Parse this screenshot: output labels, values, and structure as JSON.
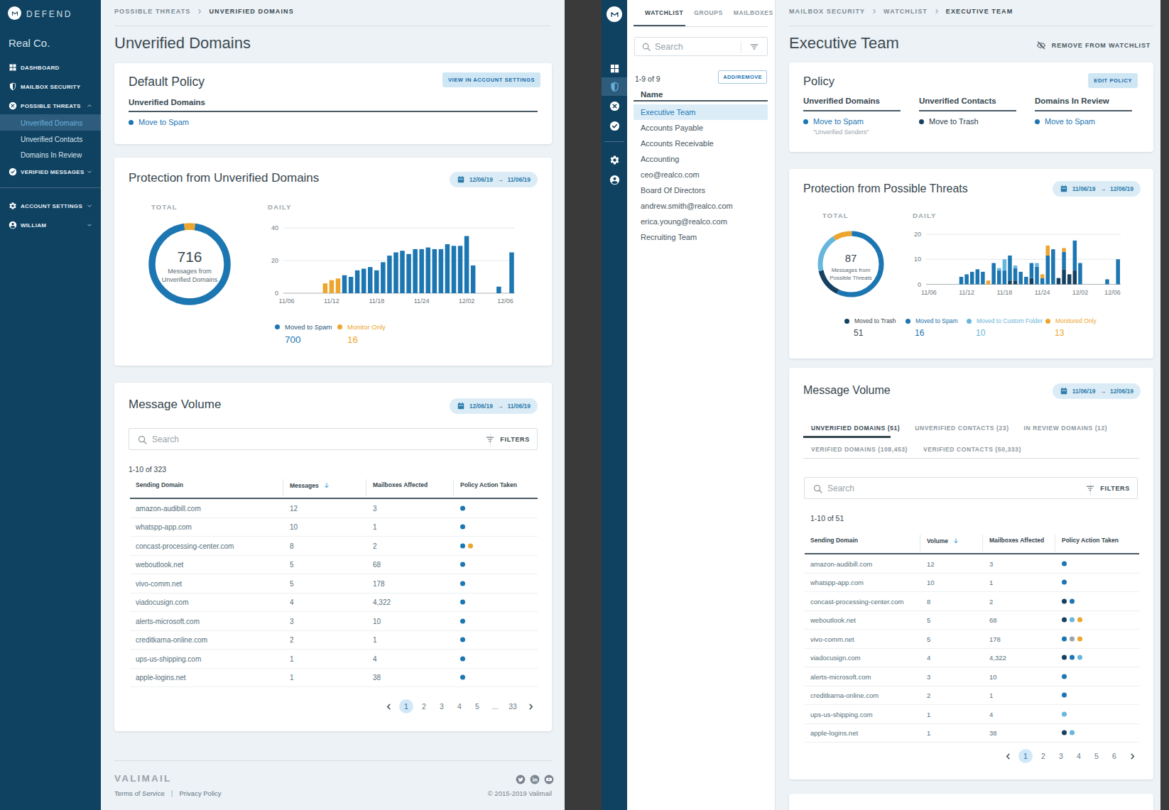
{
  "palette": {
    "blue": "#1c76b2",
    "orange": "#eda52e",
    "lightblue": "#67b7dc",
    "navy": "#16405f",
    "gray": "#9aa4ab",
    "sidebar": "#0f4161",
    "accent_chip": "#dcecf7"
  },
  "left_app": {
    "sidebar": {
      "product": "DEFEND",
      "org": "Real Co.",
      "items": [
        {
          "label": "DASHBOARD",
          "icon": "dashboard"
        },
        {
          "label": "MAILBOX SECURITY",
          "icon": "shield"
        },
        {
          "label": "POSSIBLE THREATS",
          "icon": "x-circle",
          "chevron": "up",
          "children": [
            "Unverified Domains",
            "Unverified Contacts",
            "Domains In Review"
          ],
          "selected_child": 0
        },
        {
          "label": "VERIFIED MESSAGES",
          "icon": "check-circle",
          "chevron": "down"
        }
      ],
      "footer_items": [
        {
          "label": "ACCOUNT SETTINGS",
          "icon": "gear",
          "chevron": "down"
        },
        {
          "label": "WILLIAM",
          "icon": "person",
          "chevron": "down"
        }
      ]
    },
    "breadcrumb": [
      "POSSIBLE THREATS",
      "UNVERIFIED DOMAINS"
    ],
    "page_title": "Unverified Domains",
    "default_policy": {
      "title": "Default Policy",
      "button": "VIEW IN ACCOUNT SETTINGS",
      "section_label": "Unverified Domains",
      "action": {
        "label": "Move to Spam",
        "color": "blue"
      }
    },
    "protection": {
      "title": "Protection from Unverified Domains",
      "date_from": "12/06/19",
      "date_to": "11/06/19",
      "total_label": "TOTAL",
      "daily_label": "DAILY",
      "legend": [
        {
          "label": "Moved to Spam",
          "value": "700",
          "dot": "blue",
          "label_color": "#2c5878",
          "value_color": "#1c76b2"
        },
        {
          "label": "Monitor Only",
          "value": "16",
          "dot": "orange",
          "label_color": "#eda52e",
          "value_color": "#eda52e"
        }
      ]
    },
    "message_volume": {
      "title": "Message Volume",
      "date_from": "12/06/19",
      "date_to": "11/06/19",
      "search_placeholder": "Search",
      "filters_label": "FILTERS",
      "count": "1-10 of 323",
      "columns": [
        "Sending Domain",
        "Messages",
        "Mailboxes Affected",
        "Policy Action Taken"
      ],
      "sorted_column": 1,
      "rows": [
        {
          "domain": "amazon-audibill.com",
          "messages": "12",
          "mailboxes": "3",
          "actions": [
            "blue"
          ]
        },
        {
          "domain": "whatspp-app.com",
          "messages": "10",
          "mailboxes": "1",
          "actions": [
            "blue"
          ]
        },
        {
          "domain": "concast-processing-center.com",
          "messages": "8",
          "mailboxes": "2",
          "actions": [
            "blue",
            "orange"
          ]
        },
        {
          "domain": "weboutlook.net",
          "messages": "5",
          "mailboxes": "68",
          "actions": [
            "blue"
          ]
        },
        {
          "domain": "vivo-comm.net",
          "messages": "5",
          "mailboxes": "178",
          "actions": [
            "blue"
          ]
        },
        {
          "domain": "viadocusign.com",
          "messages": "4",
          "mailboxes": "4,322",
          "actions": [
            "blue"
          ]
        },
        {
          "domain": "alerts-microsoft.com",
          "messages": "3",
          "mailboxes": "10",
          "actions": [
            "blue"
          ]
        },
        {
          "domain": "creditkarna-online.com",
          "messages": "2",
          "mailboxes": "1",
          "actions": [
            "blue"
          ]
        },
        {
          "domain": "ups-us-shipping.com",
          "messages": "1",
          "mailboxes": "4",
          "actions": [
            "blue"
          ]
        },
        {
          "domain": "apple-logins.net",
          "messages": "1",
          "mailboxes": "38",
          "actions": [
            "blue"
          ]
        }
      ],
      "pagination": [
        "1",
        "2",
        "3",
        "4",
        "5",
        "...",
        "33"
      ],
      "active_page": "1"
    },
    "footer": {
      "brand": "VALIMAIL",
      "links": [
        "Terms of Service",
        "Privacy Policy"
      ],
      "social": [
        "twitter",
        "linkedin",
        "youtube"
      ],
      "copyright": "© 2015-2019 Valimail"
    }
  },
  "right_app": {
    "mini_sidebar": {
      "items": [
        {
          "icon": "dashboard"
        },
        {
          "icon": "shield",
          "selected": true
        },
        {
          "icon": "x-circle"
        },
        {
          "icon": "check-circle"
        }
      ],
      "footer_items": [
        {
          "icon": "gear"
        },
        {
          "icon": "person"
        }
      ]
    },
    "list_panel": {
      "tabs": [
        "WATCHLIST",
        "GROUPS",
        "MAILBOXES"
      ],
      "active_tab": 0,
      "search_placeholder": "Search",
      "count": "1-9 of 9",
      "button": "ADD/REMOVE",
      "column": "Name",
      "items": [
        "Executive Team",
        "Accounts Payable",
        "Accounts Receivable",
        "Accounting",
        "ceo@realco.com",
        "Board Of Directors",
        "andrew.smith@realco.com",
        "erica.young@realco.com",
        "Recruiting Team"
      ],
      "selected_item": 0
    },
    "breadcrumb": [
      "MAILBOX SECURITY",
      "WATCHLIST",
      "EXECUTIVE TEAM"
    ],
    "page_title": "Executive Team",
    "remove_link": "REMOVE FROM WATCHLIST",
    "policy": {
      "title": "Policy",
      "button": "EDIT POLICY",
      "columns": [
        {
          "label": "Unverified Domains",
          "action": "Move to Spam",
          "color": "blue",
          "note": "\"Unverified Senders\""
        },
        {
          "label": "Unverified Contacts",
          "action": "Move to Trash",
          "color": "navy"
        },
        {
          "label": "Domains In Review",
          "action": "Move to Spam",
          "color": "blue"
        }
      ]
    },
    "protection": {
      "title": "Protection from Possible Threats",
      "date_from": "11/06/19",
      "date_to": "12/06/19",
      "total_label": "TOTAL",
      "daily_label": "DAILY",
      "legend": [
        {
          "label": "Moved to Trash",
          "value": "51",
          "dot": "navy",
          "label_color": "#37474f",
          "value_color": "#37474f"
        },
        {
          "label": "Moved to Spam",
          "value": "16",
          "dot": "blue",
          "label_color": "#1d6fa8",
          "value_color": "#1c76b2"
        },
        {
          "label": "Moved to Custom Folder",
          "value": "10",
          "dot": "lightblue",
          "label_color": "#6ab5d8",
          "value_color": "#6ab5d8"
        },
        {
          "label": "Monitored Only",
          "value": "13",
          "dot": "orange",
          "label_color": "#eda52e",
          "value_color": "#eda52e"
        }
      ]
    },
    "message_volume": {
      "title": "Message Volume",
      "date_from": "11/06/19",
      "date_to": "12/06/19",
      "tab_rows": [
        [
          "UNVERIFIED DOMAINS (51)",
          "UNVERIFIED CONTACTS (23)",
          "IN REVIEW DOMAINS (12)"
        ],
        [
          "VERIFIED DOMAINS (108,453)",
          "VERIFIED CONTACTS (50,333)"
        ]
      ],
      "active_tab": "UNVERIFIED DOMAINS (51)",
      "search_placeholder": "Search",
      "filters_label": "FILTERS",
      "count": "1-10 of 51",
      "columns": [
        "Sending Domain",
        "Volume",
        "Mailboxes Affected",
        "Policy Action Taken"
      ],
      "sorted_column": 1,
      "rows": [
        {
          "domain": "amazon-audibill.com",
          "messages": "12",
          "mailboxes": "3",
          "actions": [
            "blue"
          ]
        },
        {
          "domain": "whatspp-app.com",
          "messages": "10",
          "mailboxes": "1",
          "actions": [
            "blue"
          ]
        },
        {
          "domain": "concast-processing-center.com",
          "messages": "8",
          "mailboxes": "2",
          "actions": [
            "navy",
            "blue"
          ]
        },
        {
          "domain": "weboutlook.net",
          "messages": "5",
          "mailboxes": "68",
          "actions": [
            "navy",
            "lightblue",
            "orange"
          ]
        },
        {
          "domain": "vivo-comm.net",
          "messages": "5",
          "mailboxes": "178",
          "actions": [
            "blue",
            "gray",
            "orange"
          ]
        },
        {
          "domain": "viadocusign.com",
          "messages": "4",
          "mailboxes": "4,322",
          "actions": [
            "navy",
            "blue",
            "lightblue"
          ]
        },
        {
          "domain": "alerts-microsoft.com",
          "messages": "3",
          "mailboxes": "10",
          "actions": [
            "blue"
          ]
        },
        {
          "domain": "creditkarna-online.com",
          "messages": "2",
          "mailboxes": "1",
          "actions": [
            "blue"
          ]
        },
        {
          "domain": "ups-us-shipping.com",
          "messages": "1",
          "mailboxes": "4",
          "actions": [
            "lightblue"
          ]
        },
        {
          "domain": "apple-logins.net",
          "messages": "1",
          "mailboxes": "38",
          "actions": [
            "navy",
            "lightblue"
          ]
        }
      ],
      "pagination": [
        "1",
        "2",
        "3",
        "4",
        "5",
        "6"
      ],
      "active_page": "1"
    }
  },
  "chart_data": [
    {
      "id": "left_total_donut",
      "type": "donut",
      "title": "Messages from Unverified Domains - Total",
      "value": "716",
      "caption": [
        "Messages from",
        "Unverified Domains"
      ],
      "segments": [
        {
          "name": "Monitor Only",
          "color": "orange",
          "pct": 4.5,
          "start": 97.75
        },
        {
          "name": "Moved to Spam",
          "color": "blue",
          "pct": 95.5,
          "start": 2.25
        }
      ]
    },
    {
      "id": "left_daily",
      "type": "bar",
      "title": "Messages from Unverified Domains - Daily",
      "ylim": [
        0,
        40
      ],
      "yticks": [
        0,
        20,
        40
      ],
      "slots": 36,
      "xticks": [
        {
          "label": "11/06",
          "slot": 0
        },
        {
          "label": "11/12",
          "slot": 7
        },
        {
          "label": "11/18",
          "slot": 14
        },
        {
          "label": "11/24",
          "slot": 21
        },
        {
          "label": "12/02",
          "slot": 28
        },
        {
          "label": "12/06",
          "slot": 34
        }
      ],
      "series": {
        "monitor": "Monitor Only",
        "spam": "Moved to Spam"
      },
      "bars": [
        {
          "slot": 6,
          "value": 6,
          "series": "monitor"
        },
        {
          "slot": 7,
          "value": 8,
          "series": "monitor"
        },
        {
          "slot": 8,
          "value": 9,
          "series": "monitor"
        },
        {
          "slot": 9,
          "value": 11,
          "series": "spam"
        },
        {
          "slot": 10,
          "value": 10,
          "series": "spam"
        },
        {
          "slot": 11,
          "value": 14,
          "series": "spam"
        },
        {
          "slot": 12,
          "value": 15,
          "series": "spam"
        },
        {
          "slot": 13,
          "value": 16,
          "series": "spam"
        },
        {
          "slot": 14,
          "value": 14,
          "series": "spam"
        },
        {
          "slot": 15,
          "value": 19,
          "series": "spam"
        },
        {
          "slot": 16,
          "value": 23,
          "series": "spam"
        },
        {
          "slot": 17,
          "value": 25,
          "series": "spam"
        },
        {
          "slot": 18,
          "value": 26,
          "series": "spam"
        },
        {
          "slot": 19,
          "value": 24,
          "series": "spam"
        },
        {
          "slot": 20,
          "value": 27,
          "series": "spam"
        },
        {
          "slot": 21,
          "value": 27,
          "series": "spam"
        },
        {
          "slot": 22,
          "value": 28,
          "series": "spam"
        },
        {
          "slot": 23,
          "value": 27,
          "series": "spam"
        },
        {
          "slot": 24,
          "value": 27,
          "series": "spam"
        },
        {
          "slot": 25,
          "value": 30,
          "series": "spam"
        },
        {
          "slot": 26,
          "value": 29,
          "series": "spam"
        },
        {
          "slot": 27,
          "value": 29,
          "series": "spam"
        },
        {
          "slot": 28,
          "value": 35,
          "series": "spam"
        },
        {
          "slot": 29,
          "value": 17,
          "series": "spam"
        },
        {
          "slot": 33,
          "value": 4,
          "series": "spam"
        },
        {
          "slot": 35,
          "value": 25,
          "series": "spam"
        }
      ]
    },
    {
      "id": "right_total_donut",
      "type": "donut",
      "title": "Messages from Possible Threats - Total",
      "value": "87",
      "caption": [
        "Messages from",
        "Possible Threats"
      ],
      "segments": [
        {
          "name": "Monitored Only",
          "color": "orange",
          "pct": 9.5,
          "start": 91
        },
        {
          "name": "Moved to Spam",
          "color": "blue",
          "pct": 56.5,
          "start": 0.5
        },
        {
          "name": "Moved to Trash",
          "color": "navy",
          "pct": 14.5,
          "start": 57
        },
        {
          "name": "Moved to Custom Folder",
          "color": "lightblue",
          "pct": 19.5,
          "start": 71.5
        }
      ]
    },
    {
      "id": "right_daily",
      "type": "stacked-bar",
      "title": "Messages from Possible Threats - Daily",
      "ylim": [
        0,
        20
      ],
      "yticks": [
        0,
        10,
        20
      ],
      "slots": 36,
      "xticks": [
        {
          "label": "11/06",
          "slot": 0
        },
        {
          "label": "11/12",
          "slot": 7
        },
        {
          "label": "11/18",
          "slot": 14
        },
        {
          "label": "11/24",
          "slot": 21
        },
        {
          "label": "12/02",
          "slot": 28
        },
        {
          "label": "12/06",
          "slot": 34
        }
      ],
      "stack_order": [
        "trash",
        "spam",
        "custom",
        "monitor"
      ],
      "stack_colors": {
        "trash": "navy",
        "spam": "blue",
        "custom": "lightblue",
        "monitor": "orange"
      },
      "bars": [
        {
          "slot": 6,
          "trash": 0,
          "spam": 3,
          "custom": 0,
          "monitor": 0
        },
        {
          "slot": 7,
          "trash": 0,
          "spam": 4,
          "custom": 0,
          "monitor": 0
        },
        {
          "slot": 8,
          "trash": 0,
          "spam": 5,
          "custom": 0,
          "monitor": 0
        },
        {
          "slot": 9,
          "trash": 0,
          "spam": 6,
          "custom": 0,
          "monitor": 0
        },
        {
          "slot": 10,
          "trash": 0,
          "spam": 5,
          "custom": 0,
          "monitor": 0
        },
        {
          "slot": 11,
          "trash": 0,
          "spam": 0,
          "custom": 0,
          "monitor": 1.5
        },
        {
          "slot": 12,
          "trash": 0,
          "spam": 8.5,
          "custom": 0,
          "monitor": 0
        },
        {
          "slot": 13,
          "trash": 0,
          "spam": 5.5,
          "custom": 1,
          "monitor": 0
        },
        {
          "slot": 14,
          "trash": 0,
          "spam": 5.5,
          "custom": 4.5,
          "monitor": 0
        },
        {
          "slot": 15,
          "trash": 1.5,
          "spam": 10,
          "custom": 0,
          "monitor": 0
        },
        {
          "slot": 16,
          "trash": 1.5,
          "spam": 5,
          "custom": 1,
          "monitor": 0
        },
        {
          "slot": 17,
          "trash": 0,
          "spam": 5,
          "custom": 0,
          "monitor": 0
        },
        {
          "slot": 18,
          "trash": 0,
          "spam": 3,
          "custom": 0,
          "monitor": 0
        },
        {
          "slot": 19,
          "trash": 2.5,
          "spam": 6,
          "custom": 0,
          "monitor": 0
        },
        {
          "slot": 20,
          "trash": 0,
          "spam": 7,
          "custom": 1.5,
          "monitor": 0
        },
        {
          "slot": 21,
          "trash": 0,
          "spam": 2.5,
          "custom": 0,
          "monitor": 1.5
        },
        {
          "slot": 22,
          "trash": 0,
          "spam": 11.5,
          "custom": 0,
          "monitor": 4
        },
        {
          "slot": 23,
          "trash": 0,
          "spam": 14,
          "custom": 0,
          "monitor": 0
        },
        {
          "slot": 24,
          "trash": 2.5,
          "spam": 0,
          "custom": 0,
          "monitor": 0
        },
        {
          "slot": 25,
          "trash": 6,
          "spam": 7,
          "custom": 0,
          "monitor": 1.5
        },
        {
          "slot": 26,
          "trash": 4,
          "spam": 0,
          "custom": 0,
          "monitor": 0
        },
        {
          "slot": 27,
          "trash": 5.5,
          "spam": 12,
          "custom": 0,
          "monitor": 0
        },
        {
          "slot": 28,
          "trash": 0,
          "spam": 8.5,
          "custom": 0,
          "monitor": 0
        },
        {
          "slot": 33,
          "trash": 0,
          "spam": 2,
          "custom": 0,
          "monitor": 0
        },
        {
          "slot": 35,
          "trash": 0,
          "spam": 10,
          "custom": 0,
          "monitor": 0
        }
      ]
    }
  ]
}
